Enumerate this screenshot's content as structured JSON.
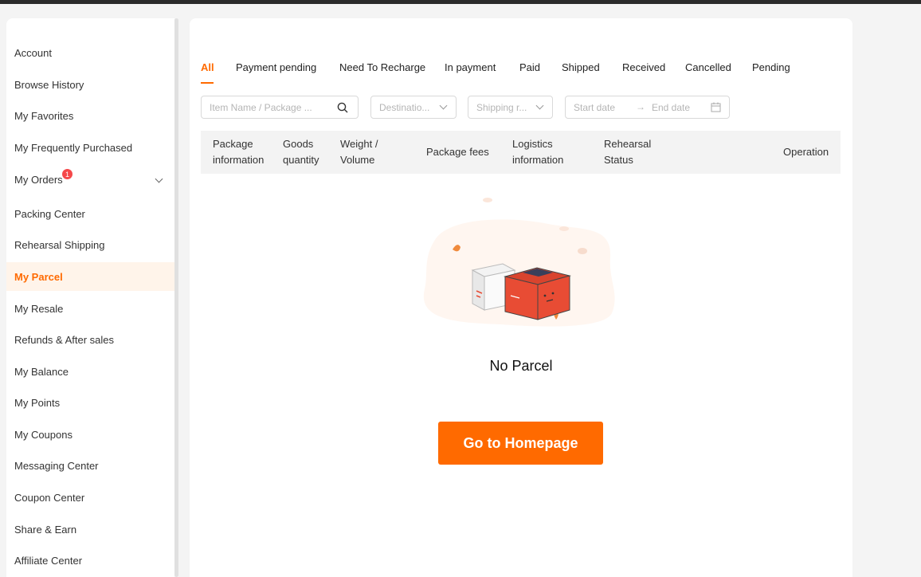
{
  "sidebar": {
    "items": [
      {
        "label": "Account"
      },
      {
        "label": "Browse History"
      },
      {
        "label": "My Favorites"
      },
      {
        "label": "My Frequently Purchased"
      },
      {
        "label": "My Orders",
        "badge": "1"
      },
      {
        "label": "Packing Center"
      },
      {
        "label": "Rehearsal Shipping"
      },
      {
        "label": "My Parcel",
        "active": true
      },
      {
        "label": "My Resale"
      },
      {
        "label": "Refunds & After sales"
      },
      {
        "label": "My Balance"
      },
      {
        "label": "My Points"
      },
      {
        "label": "My Coupons"
      },
      {
        "label": "Messaging Center"
      },
      {
        "label": "Coupon Center"
      },
      {
        "label": "Share & Earn"
      },
      {
        "label": "Affiliate Center"
      }
    ]
  },
  "tabs": [
    "All",
    "Payment pending",
    "Need To Recharge",
    "In payment",
    "Paid",
    "Shipped",
    "Received",
    "Cancelled",
    "Pending"
  ],
  "filters": {
    "search_placeholder": "Item Name / Package ...",
    "destination_placeholder": "Destinatio...",
    "shipping_placeholder": "Shipping r...",
    "start_date": "Start date",
    "end_date": "End date",
    "date_arrow": "→"
  },
  "table": {
    "columns": [
      [
        "Package",
        "information"
      ],
      [
        "Goods",
        "quantity"
      ],
      [
        "Weight /",
        "Volume"
      ],
      [
        "Package fees"
      ],
      [
        "Logistics",
        "information"
      ],
      [
        "Rehearsal",
        "Status"
      ],
      [
        "Operation"
      ]
    ]
  },
  "empty": {
    "message": "No Parcel",
    "button_label": "Go to Homepage"
  },
  "colors": {
    "accent": "#ff6a00",
    "badge": "#f5484a",
    "box_red": "#e84c34"
  }
}
